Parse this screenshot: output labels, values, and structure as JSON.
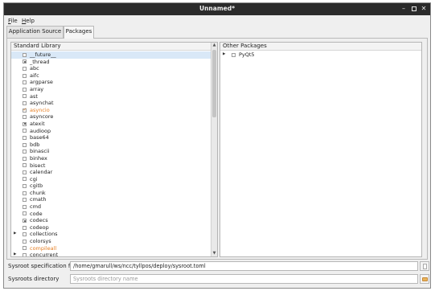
{
  "window": {
    "title": "Unnamed*"
  },
  "menubar": {
    "items": [
      {
        "label": "File",
        "mnemonic": "F",
        "rest": "ile"
      },
      {
        "label": "Help",
        "mnemonic": "H",
        "rest": "elp"
      }
    ]
  },
  "tabs": [
    {
      "label": "Application Source",
      "active": false
    },
    {
      "label": "Packages",
      "active": true
    }
  ],
  "standard_library": {
    "header": "Standard Library",
    "items": [
      {
        "label": "__future__",
        "state": "unchecked",
        "arrow": false,
        "color": "default",
        "selected": true
      },
      {
        "label": "_thread",
        "state": "partial",
        "arrow": false,
        "color": "default"
      },
      {
        "label": "abc",
        "state": "unchecked",
        "arrow": false,
        "color": "default"
      },
      {
        "label": "aifc",
        "state": "unchecked",
        "arrow": false,
        "color": "default"
      },
      {
        "label": "argparse",
        "state": "unchecked",
        "arrow": false,
        "color": "default"
      },
      {
        "label": "array",
        "state": "unchecked",
        "arrow": false,
        "color": "default"
      },
      {
        "label": "ast",
        "state": "unchecked",
        "arrow": false,
        "color": "default"
      },
      {
        "label": "asynchat",
        "state": "unchecked",
        "arrow": false,
        "color": "default"
      },
      {
        "label": "asyncio",
        "state": "checked",
        "arrow": false,
        "color": "orange"
      },
      {
        "label": "asyncore",
        "state": "unchecked",
        "arrow": false,
        "color": "default"
      },
      {
        "label": "atexit",
        "state": "partial",
        "arrow": false,
        "color": "default"
      },
      {
        "label": "audioop",
        "state": "unchecked",
        "arrow": false,
        "color": "default"
      },
      {
        "label": "base64",
        "state": "unchecked",
        "arrow": false,
        "color": "default"
      },
      {
        "label": "bdb",
        "state": "unchecked",
        "arrow": false,
        "color": "default"
      },
      {
        "label": "binascii",
        "state": "unchecked",
        "arrow": false,
        "color": "default"
      },
      {
        "label": "binhex",
        "state": "unchecked",
        "arrow": false,
        "color": "default"
      },
      {
        "label": "bisect",
        "state": "unchecked",
        "arrow": false,
        "color": "default"
      },
      {
        "label": "calendar",
        "state": "unchecked",
        "arrow": false,
        "color": "default"
      },
      {
        "label": "cgi",
        "state": "unchecked",
        "arrow": false,
        "color": "default"
      },
      {
        "label": "cgitb",
        "state": "unchecked",
        "arrow": false,
        "color": "default"
      },
      {
        "label": "chunk",
        "state": "unchecked",
        "arrow": false,
        "color": "default"
      },
      {
        "label": "cmath",
        "state": "unchecked",
        "arrow": false,
        "color": "default"
      },
      {
        "label": "cmd",
        "state": "unchecked",
        "arrow": false,
        "color": "default"
      },
      {
        "label": "code",
        "state": "unchecked",
        "arrow": false,
        "color": "default"
      },
      {
        "label": "codecs",
        "state": "partial",
        "arrow": false,
        "color": "default"
      },
      {
        "label": "codeop",
        "state": "unchecked",
        "arrow": false,
        "color": "default"
      },
      {
        "label": "collections",
        "state": "unchecked",
        "arrow": true,
        "color": "default"
      },
      {
        "label": "colorsys",
        "state": "unchecked",
        "arrow": false,
        "color": "default"
      },
      {
        "label": "compileall",
        "state": "unchecked",
        "arrow": false,
        "color": "orange"
      },
      {
        "label": "concurrent",
        "state": "unchecked",
        "arrow": true,
        "color": "default"
      }
    ]
  },
  "other_packages": {
    "header": "Other Packages",
    "items": [
      {
        "label": "PyQt5",
        "state": "unchecked",
        "arrow": true,
        "color": "default"
      }
    ]
  },
  "fields": {
    "sysroot_spec": {
      "label": "Sysroot specification file",
      "value": "/home/gmarull/ws/ncc/tyllpos/deploy/sysroot.toml",
      "placeholder": "",
      "button_icon": "file-icon"
    },
    "sysroots_dir": {
      "label": "Sysroots directory",
      "value": "",
      "placeholder": "Sysroots directory name",
      "button_icon": "folder-icon"
    }
  },
  "colors": {
    "titlebar": "#2b2b2b",
    "accent_orange": "#e67e22",
    "selection": "#d9e8f7"
  }
}
